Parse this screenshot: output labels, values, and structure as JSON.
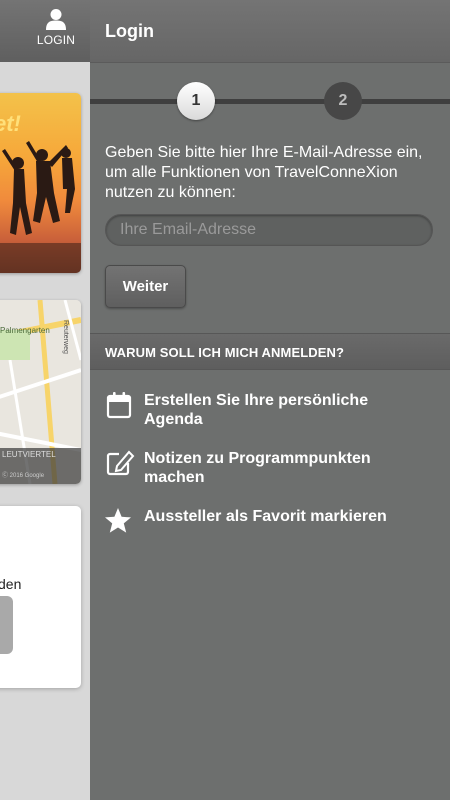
{
  "background_app": {
    "login_label": "LOGIN",
    "photo_card_text": "et!",
    "map_label": "Palmengarten",
    "map_street": "Reuterweg",
    "map_bottom_text": "LEUTVIERTEL",
    "map_copyright": "Ⓒ 2016 Google",
    "white_card_word": "den"
  },
  "panel": {
    "title": "Login",
    "steps": [
      "1",
      "2"
    ],
    "intro": "Geben Sie bitte hier Ihre E-Mail-Adresse ein, um alle Funktionen von TravelConneXion nutzen zu können:",
    "email_placeholder": "Ihre Email-Adresse",
    "email_value": "",
    "next_button": "Weiter",
    "why_heading": "WARUM SOLL ICH MICH ANMELDEN?",
    "features": [
      {
        "icon": "calendar-icon",
        "text": "Erstellen Sie Ihre persönliche Agenda"
      },
      {
        "icon": "edit-icon",
        "text": "Notizen zu Programmpunkten machen"
      },
      {
        "icon": "star-icon",
        "text": "Aussteller als Favorit markieren"
      }
    ]
  },
  "colors": {
    "panel_bg": "#6d6f6e",
    "header_bg": "#6b6b6b",
    "step_active": "#ffffff",
    "step_inactive": "#474747"
  }
}
